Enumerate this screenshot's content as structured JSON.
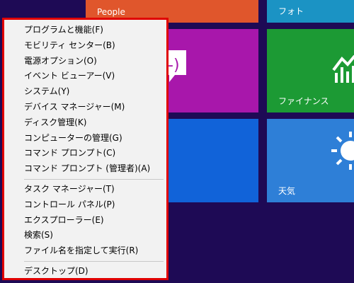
{
  "tiles": {
    "people": "People",
    "photo": "フォト",
    "finance": "ファイナンス",
    "weather": "天気"
  },
  "menu": {
    "groups": [
      [
        "プログラムと機能(F)",
        "モビリティ センター(B)",
        "電源オプション(O)",
        "イベント ビューアー(V)",
        "システム(Y)",
        "デバイス マネージャー(M)",
        "ディスク管理(K)",
        "コンピューターの管理(G)",
        "コマンド プロンプト(C)",
        "コマンド プロンプト (管理者)(A)"
      ],
      [
        "タスク マネージャー(T)",
        "コントロール パネル(P)",
        "エクスプローラー(E)",
        "検索(S)",
        "ファイル名を指定して実行(R)"
      ],
      [
        "デスクトップ(D)"
      ]
    ]
  },
  "colors": {
    "background": "#1e0a55",
    "menu_border": "#e00000",
    "menu_bg": "#f2f2f2",
    "people": "#e0562c",
    "photo": "#1b93c4",
    "messaging": "#a817ab",
    "finance": "#1c9a34",
    "ie": "#1163d9",
    "weather": "#2e7fd7"
  },
  "icons": [
    "messaging-icon",
    "finance-chart-icon",
    "sun-icon"
  ]
}
